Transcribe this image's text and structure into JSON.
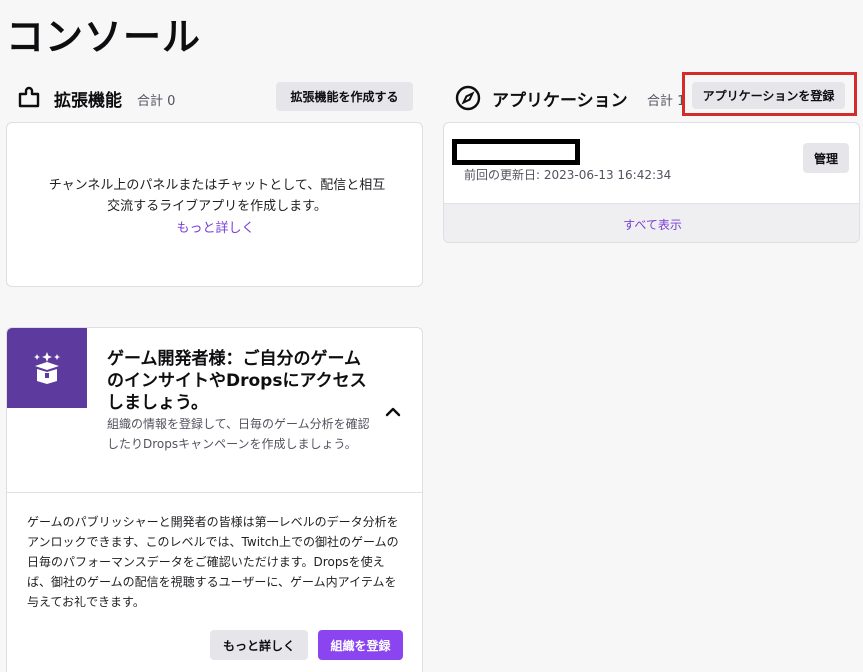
{
  "page": {
    "title": "コンソール"
  },
  "extensions": {
    "title": "拡張機能",
    "count_label": "合計 0",
    "create_button": "拡張機能を作成する",
    "description": "チャンネル上のパネルまたはチャットとして、配信と相互交流するライブアプリを作成します。",
    "more_link": "もっと詳しく",
    "icon": "puzzle-piece-icon"
  },
  "applications": {
    "title": "アプリケーション",
    "count_label": "合計 1",
    "register_button": "アプリケーションを登録",
    "icon": "compass-icon",
    "items": [
      {
        "updated": "前回の更新日: 2023-06-13 16:42:34",
        "manage_button": "管理"
      }
    ],
    "show_all": "すべて表示"
  },
  "game_dev": {
    "title": "ゲーム開発者様：ご自分のゲームのインサイトやDropsにアクセスしましょう。",
    "subtitle": "組織の情報を登録して、日毎のゲーム分析を確認したりDropsキャンペーンを作成しましょう。",
    "body": "ゲームのパブリッシャーと開発者の皆様は第一レベルのデータ分析をアンロックできます、このレベルでは、Twitch上での御社のゲームの日毎のパフォーマンスデータをご確認いただけます。Dropsを使えば、御社のゲームの配信を視聴するユーザーに、ゲーム内アイテムを与えてお礼できます。",
    "more_button": "もっと詳しく",
    "register_button": "組織を登録",
    "icon": "gift-box-sparkle-icon"
  },
  "colors": {
    "accent": "#8a45f0",
    "link": "#7a3fd6",
    "highlight": "#d42b2b",
    "thumb": "#5c3a9e"
  }
}
